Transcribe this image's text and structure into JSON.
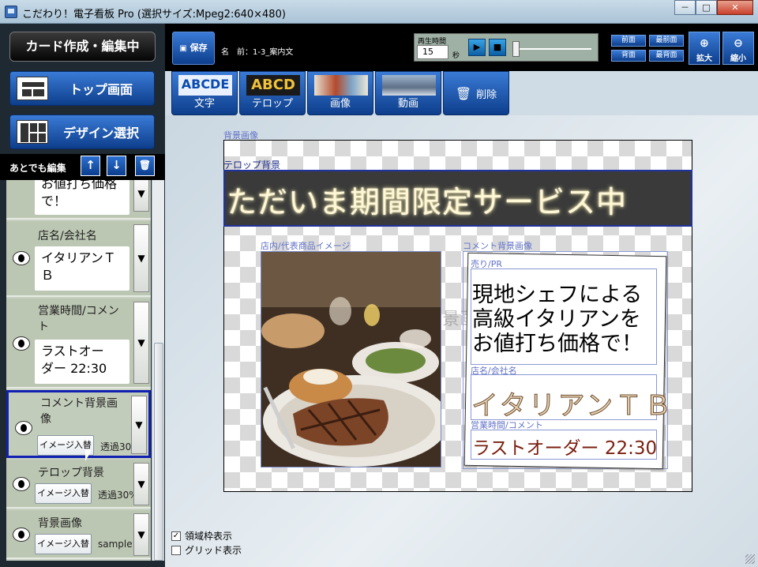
{
  "window": {
    "title": "こだわり！電子看板 Pro (選択サイズ:Mpeg2:640×480)",
    "minimize": "－",
    "maximize": "□",
    "close": "✕"
  },
  "sidebar": {
    "mode_label": "カード作成・編集中",
    "top_button": "トップ画面",
    "design_button": "デザイン選択",
    "edit_label": "あとでも編集",
    "up_icon": "↑",
    "down_icon": "↓",
    "trash_icon": "🗑",
    "items": [
      {
        "name": "",
        "text": "お値打ち価格\nで！",
        "dropdown": "▼"
      },
      {
        "name": "店名/会社名",
        "text": "イタリアンＴ\nＢ",
        "dropdown": "▼"
      },
      {
        "name": "営業時間/コメント",
        "text": "ラストオー\nダー 22:30",
        "dropdown": "▼"
      },
      {
        "name": "コメント背景画像",
        "button": "イメージ入替",
        "value": "透過30%",
        "dropdown": "▼"
      },
      {
        "name": "テロップ背景",
        "button": "イメージ入替",
        "value": "透過30%",
        "dropdown": "▼"
      },
      {
        "name": "背景画像",
        "button": "イメージ入替",
        "value": "sample",
        "dropdown": "▼"
      }
    ]
  },
  "topbar": {
    "save_label": "保存",
    "name_label": "名　前：1-3_案内文",
    "play_time_label": "再生時間",
    "play_time_value": "15",
    "play_time_unit": "秒",
    "play_icon": "▶",
    "stop_icon": "■",
    "layer_front": "前面",
    "layer_frontmost": "最前面",
    "layer_back": "背面",
    "layer_backmost": "最背面",
    "zoom_in": "拡大",
    "zoom_out": "縮小"
  },
  "toolbar": {
    "text_tool": "文字",
    "telop_tool": "テロップ",
    "image_tool": "画像",
    "video_tool": "動画",
    "delete_tool": "削除",
    "text_thumb": "ABCDE",
    "telop_thumb": "ABCD"
  },
  "canvas": {
    "bg_label": "背景画像",
    "telop_bg_label": "テロップ背景",
    "telop_text": "ただいま期間限定サービス中",
    "photo_label": "店内/代表商品イメージ",
    "comment_bg_label": "コメント背景画像",
    "pr_label": "売り/PR",
    "pr_text": "現地シェフによる\n高級イタリアンを\nお値打ち価格で！",
    "shop_label": "店名/会社名",
    "shop_text": "イタリアンＴＢ",
    "hours_label": "営業時間/コメント",
    "hours_text": "ラストオーダー 22:30"
  },
  "options": {
    "show_regions_label": "領域枠表示",
    "show_regions_checked": true,
    "show_grid_label": "グリッド表示",
    "show_grid_checked": false
  },
  "colors": {
    "accent_blue": "#0d3e8c",
    "selection_border": "#1020b0",
    "sidebar_bg": "#1e2932"
  }
}
